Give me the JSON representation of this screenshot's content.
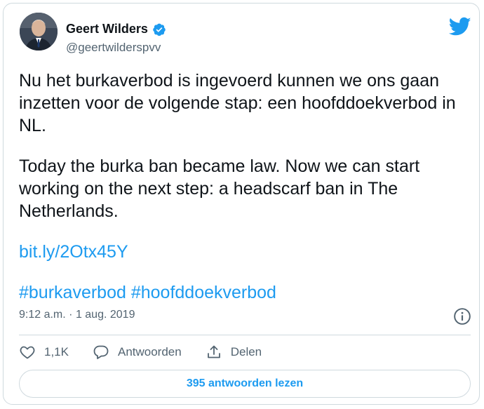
{
  "author": {
    "name": "Geert Wilders",
    "handle": "@geertwilderspvv",
    "verified": true
  },
  "tweet": {
    "paragraph_1": "Nu het burkaverbod is ingevoerd kunnen we ons gaan inzetten voor de volgende stap: een hoofddoekverbod in NL.",
    "paragraph_2": "Today the burka ban became law. Now we can start working on the next step: a headscarf ban in The Netherlands.",
    "link": "bit.ly/2Otx45Y",
    "hashtags": [
      "#burkaverbod",
      "#hoofddoekverbod"
    ]
  },
  "meta": {
    "time": "9:12 a.m.",
    "separator": "·",
    "date": "1 aug. 2019"
  },
  "actions": {
    "likes": "1,1K",
    "reply_label": "Antwoorden",
    "share_label": "Delen"
  },
  "read_replies_label": "395 antwoorden lezen",
  "colors": {
    "accent": "#1d9bf0",
    "text": "#0f1419",
    "secondary": "#536471",
    "border": "#cfd9de"
  },
  "icons": [
    "verified-badge-icon",
    "twitter-bird-icon",
    "info-icon",
    "heart-icon",
    "reply-bubble-icon",
    "share-icon"
  ]
}
